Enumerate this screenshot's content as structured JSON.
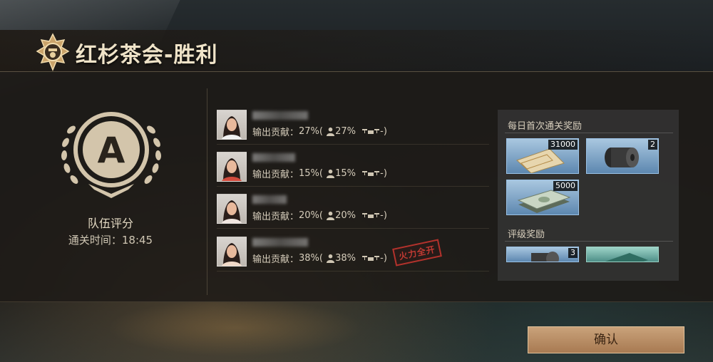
{
  "header": {
    "title": "红杉茶会-胜利",
    "emblem_icon": "military-emblem-icon"
  },
  "rating": {
    "grade": "A",
    "label": "队伍评分",
    "clear_time": "通关时间：18:45"
  },
  "members": [
    {
      "contribution_label": "输出贡献：",
      "contribution": "27%(",
      "share": "27%",
      "drone_text": "-)"
    },
    {
      "contribution_label": "输出贡献：",
      "contribution": "15%(",
      "share": "15%",
      "drone_text": "-)"
    },
    {
      "contribution_label": "输出贡献：",
      "contribution": "20%(",
      "share": "20%",
      "drone_text": "-)"
    },
    {
      "contribution_label": "输出贡献：",
      "contribution": "38%(",
      "share": "38%",
      "drone_text": "-)"
    }
  ],
  "stamp": {
    "text": "火力全开"
  },
  "rewards": {
    "daily_title": "每日首次通关奖励",
    "daily_items": [
      {
        "icon": "ticket-icon",
        "count": "31000"
      },
      {
        "icon": "film-roll-icon",
        "count": "2"
      },
      {
        "icon": "cash-stack-icon",
        "count": "5000"
      }
    ],
    "rating_title": "评级奖励",
    "rating_items": [
      {
        "icon": "film-roll-icon",
        "count": "3"
      },
      {
        "icon": "cash-stack-icon",
        "count": ""
      }
    ]
  },
  "confirm": {
    "label": "确认"
  },
  "colors": {
    "accent": "#c9a27a",
    "stamp": "#c23a33",
    "item_bg": "#5d87b0"
  }
}
